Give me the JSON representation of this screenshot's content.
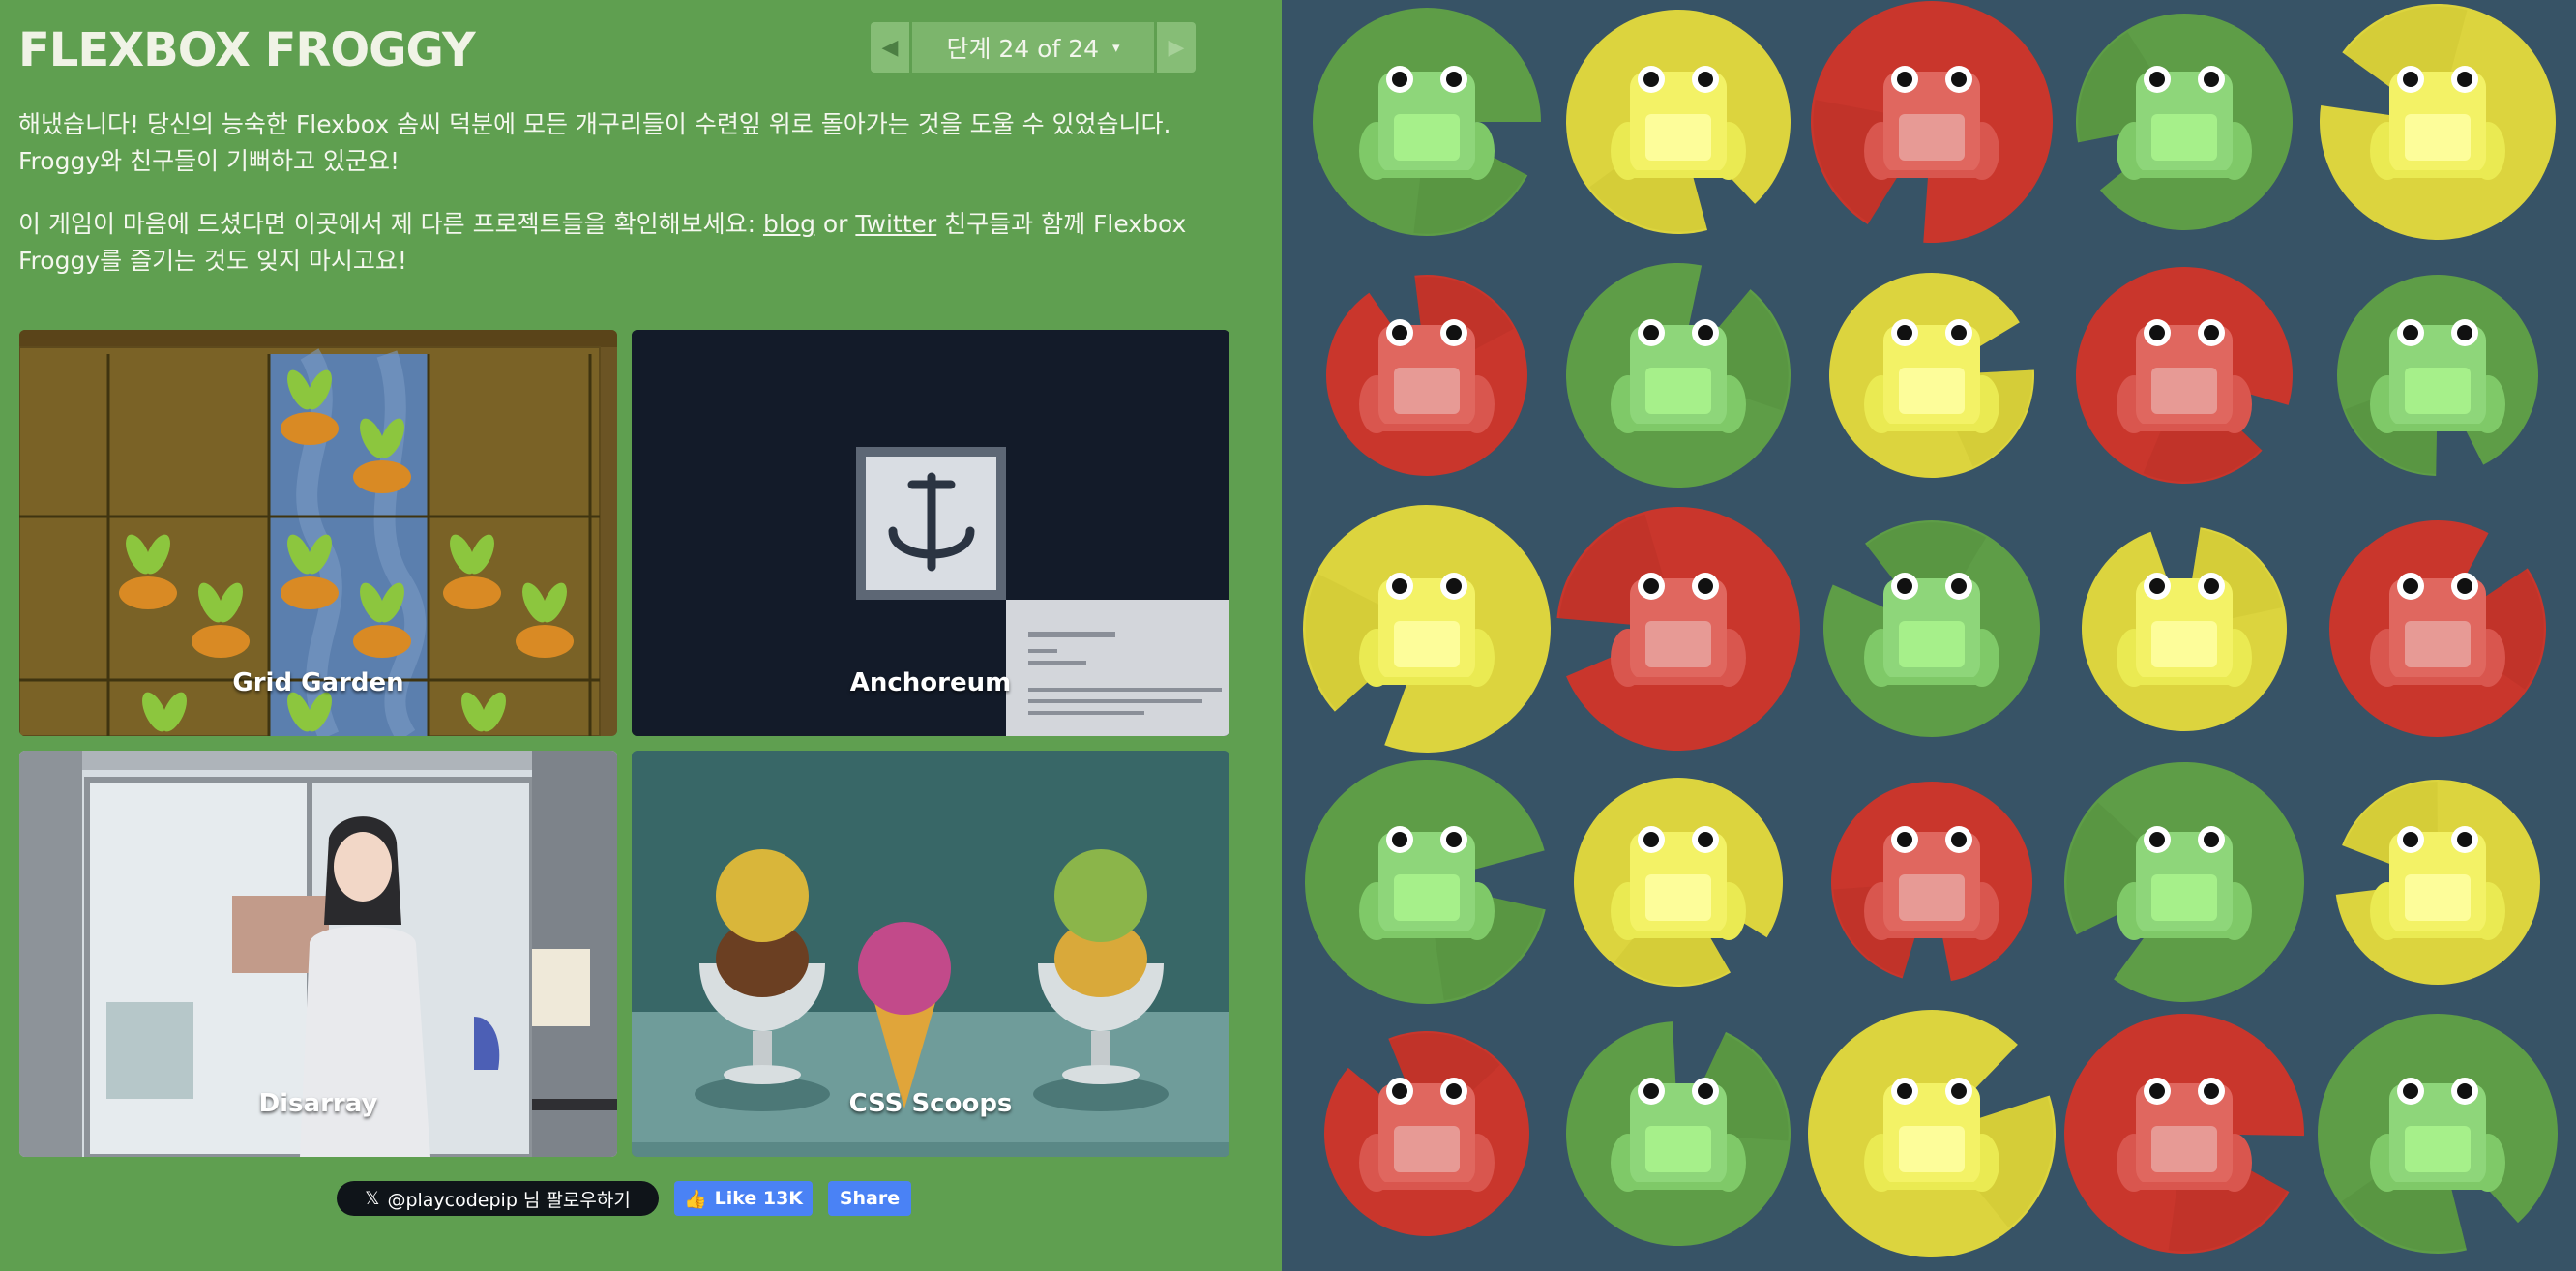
{
  "header": {
    "title": "FLEXBOX FROGGY",
    "level_label": "단계 24 of 24",
    "prev_arrow": "◀",
    "next_arrow": "▶",
    "caret": "▾"
  },
  "messages": {
    "p1": "해냈습니다! 당신의 능숙한 Flexbox 솜씨 덕분에 모든 개구리들이 수련잎 위로 돌아가는 것을 도울 수 있었습니다. Froggy와 친구들이 기뻐하고 있군요!",
    "p2_before": "이 게임이 마음에 드셨다면 이곳에서 제 다른 프로젝트들을 확인해보세요: ",
    "p2_link_blog": "blog",
    "p2_or": " or ",
    "p2_link_twitter": "Twitter",
    "p2_after": " 친구들과 함께 Flexbox Froggy를 즐기는 것도 잊지 마시고요!"
  },
  "projects": [
    {
      "label": "Grid Garden"
    },
    {
      "label": "Anchoreum"
    },
    {
      "label": "Disarray"
    },
    {
      "label": "CSS Scoops"
    }
  ],
  "social": {
    "twitter_label": "@playcodepip 님 팔로우하기",
    "twitter_icon": "𝕏",
    "like_label": "Like 13K",
    "like_icon": "👍",
    "share_label": "Share"
  },
  "colors": {
    "green": "#5e9d47",
    "yellow": "#dcd43e",
    "red": "#c9362c",
    "board_bg": "#375366",
    "sidebar_bg": "#5f9f50"
  },
  "board": {
    "rows": [
      [
        "green",
        "yellow",
        "red",
        "green",
        "yellow"
      ],
      [
        "red",
        "green",
        "yellow",
        "red",
        "green"
      ],
      [
        "yellow",
        "red",
        "green",
        "yellow",
        "red"
      ],
      [
        "green",
        "yellow",
        "red",
        "green",
        "yellow"
      ],
      [
        "red",
        "green",
        "yellow",
        "red",
        "green"
      ]
    ]
  }
}
